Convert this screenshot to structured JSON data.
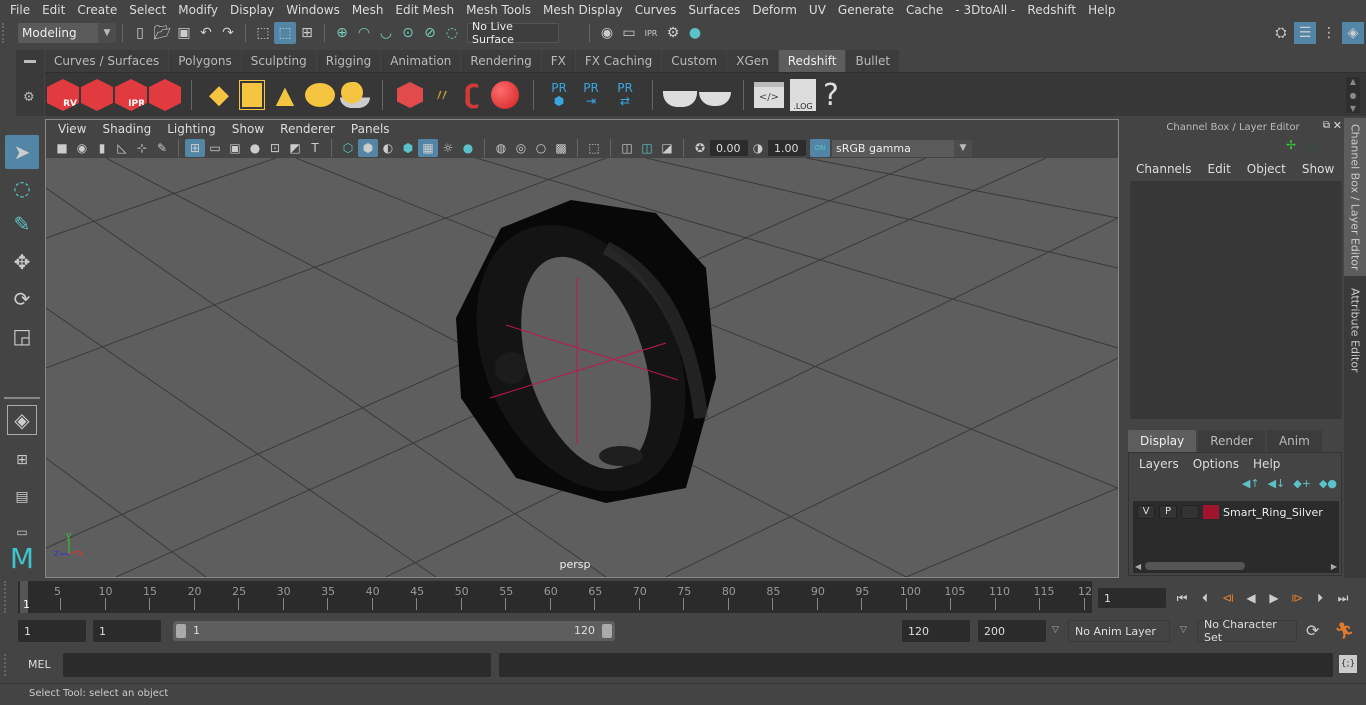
{
  "menubar": {
    "items": [
      "File",
      "Edit",
      "Create",
      "Select",
      "Modify",
      "Display",
      "Windows",
      "Mesh",
      "Edit Mesh",
      "Mesh Tools",
      "Mesh Display",
      "Curves",
      "Surfaces",
      "Deform",
      "UV",
      "Generate",
      "Cache",
      "- 3DtoAll -",
      "Redshift",
      "Help"
    ]
  },
  "statusline": {
    "mode_dropdown": "Modeling",
    "live_surface": "No Live Surface"
  },
  "shelf": {
    "tabs": [
      "Curves / Surfaces",
      "Polygons",
      "Sculpting",
      "Rigging",
      "Animation",
      "Rendering",
      "FX",
      "FX Caching",
      "Custom",
      "XGen",
      "Redshift",
      "Bullet"
    ],
    "active_tab": "Redshift",
    "icons": [
      {
        "name": "redshift-render-view-icon",
        "label": "RV"
      },
      {
        "name": "redshift-batch-render-icon",
        "label": ""
      },
      {
        "name": "redshift-ipr-icon",
        "label": "IPR"
      },
      {
        "name": "redshift-render-settings-icon",
        "label": ""
      },
      {
        "name": "redshift-area-light-icon",
        "label": ""
      },
      {
        "name": "redshift-portal-light-icon",
        "label": ""
      },
      {
        "name": "redshift-spot-light-icon",
        "label": ""
      },
      {
        "name": "redshift-dome-light-icon",
        "label": ""
      },
      {
        "name": "redshift-sun-sky-icon",
        "label": ""
      },
      {
        "name": "redshift-volume-icon",
        "label": ""
      },
      {
        "name": "redshift-hair-icon",
        "label": ""
      },
      {
        "name": "redshift-mesh-light-icon",
        "label": ""
      },
      {
        "name": "redshift-sphere-icon",
        "label": ""
      },
      {
        "name": "redshift-proxy-icon",
        "label": "PR"
      },
      {
        "name": "redshift-proxy-export-icon",
        "label": "PR"
      },
      {
        "name": "redshift-proxy-convert-icon",
        "label": "PR"
      },
      {
        "name": "redshift-bake-multi-icon",
        "label": ""
      },
      {
        "name": "redshift-bake-icon",
        "label": ""
      },
      {
        "name": "redshift-script-icon",
        "label": ""
      },
      {
        "name": "redshift-log-icon",
        "label": ".LOG"
      },
      {
        "name": "redshift-help-icon",
        "label": "?"
      }
    ]
  },
  "viewport": {
    "menus": [
      "View",
      "Shading",
      "Lighting",
      "Show",
      "Renderer",
      "Panels"
    ],
    "exposure": "0.00",
    "gamma": "1.00",
    "color_space": "sRGB gamma",
    "color_mgmt_toggle": "ON",
    "camera_label": "persp",
    "axis_labels": {
      "x": "x",
      "y": "y",
      "z": "z"
    }
  },
  "channel_box": {
    "title": "Channel Box / Layer Editor",
    "menus": [
      "Channels",
      "Edit",
      "Object",
      "Show"
    ],
    "layer_tabs": [
      "Display",
      "Render",
      "Anim"
    ],
    "active_layer_tab": "Display",
    "layer_menus": [
      "Layers",
      "Options",
      "Help"
    ],
    "layers": [
      {
        "visible": "V",
        "playback": "P",
        "type": "",
        "color": "#a0142e",
        "name": "Smart_Ring_Silver"
      }
    ]
  },
  "side_tabs": [
    "Channel Box / Layer Editor",
    "Attribute Editor"
  ],
  "timeline": {
    "ticks": [
      "5",
      "10",
      "15",
      "20",
      "25",
      "30",
      "35",
      "40",
      "45",
      "50",
      "55",
      "60",
      "65",
      "70",
      "75",
      "80",
      "85",
      "90",
      "95",
      "100",
      "105",
      "110",
      "115",
      "12"
    ],
    "current_frame_marker": "1",
    "current_frame_field": "1"
  },
  "range": {
    "start_field": "1",
    "playback_start": "1",
    "slider_start": "1",
    "slider_end": "120",
    "playback_end": "120",
    "end_field": "200",
    "anim_layer": "No Anim Layer",
    "character_set": "No Character Set"
  },
  "command_line": {
    "language": "MEL",
    "input": "",
    "output": ""
  },
  "help_line": "Select Tool: select an object"
}
